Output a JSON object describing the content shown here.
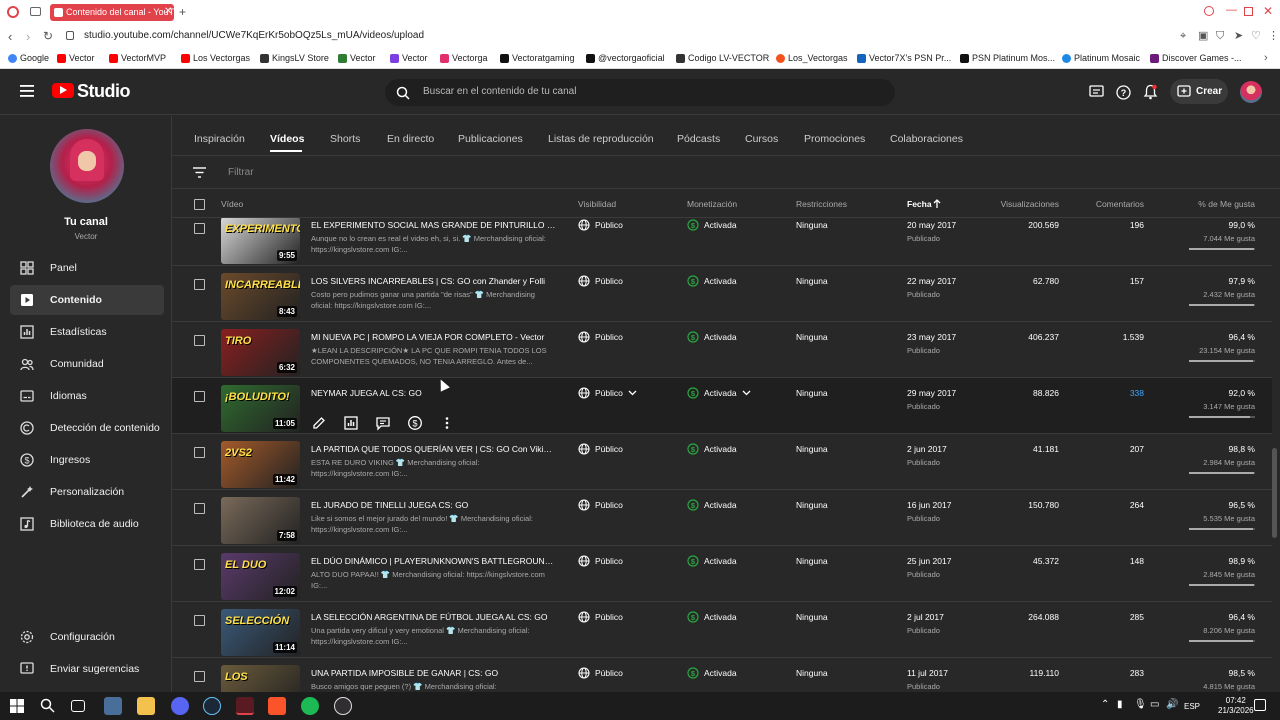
{
  "browser": {
    "tab_title": "Contenido del canal - YouT",
    "url": "studio.youtube.com/channel/UCWe7KqErKr5obOQz5Ls_mUA/videos/upload",
    "bookmarks": [
      {
        "label": "Google",
        "color": "#4285f4"
      },
      {
        "label": "Vector",
        "color": "#ff0000"
      },
      {
        "label": "VectorMVP",
        "color": "#ff0000"
      },
      {
        "label": "Los Vectorgas",
        "color": "#ff0000"
      },
      {
        "label": "KingsLV Store",
        "color": "#333333"
      },
      {
        "label": "Vector",
        "color": "#2e7d32"
      },
      {
        "label": "Vector",
        "color": "#7b3fe4"
      },
      {
        "label": "Vectorga",
        "color": "#e1306c"
      },
      {
        "label": "Vectoratgaming",
        "color": "#111111"
      },
      {
        "label": "@vectorgaoficial",
        "color": "#111111"
      },
      {
        "label": "Codigo LV-VECTOR",
        "color": "#333333"
      },
      {
        "label": "Los_Vectorgas",
        "color": "#f4511e"
      },
      {
        "label": "Vector7X's PSN Pr...",
        "color": "#1565c0"
      },
      {
        "label": "PSN Platinum Mos...",
        "color": "#111111"
      },
      {
        "label": "Platinum Mosaic",
        "color": "#1e88e5"
      },
      {
        "label": "Discover Games -...",
        "color": "#6d1b7b"
      }
    ]
  },
  "header": {
    "logo_text": "Studio",
    "search_placeholder": "Buscar en el contenido de tu canal",
    "create_label": "Crear"
  },
  "sidebar": {
    "your_channel": "Tu canal",
    "channel_name": "Vector",
    "items": [
      {
        "label": "Panel",
        "icon": "dashboard-icon"
      },
      {
        "label": "Contenido",
        "icon": "content-icon",
        "active": true
      },
      {
        "label": "Estadísticas",
        "icon": "analytics-icon"
      },
      {
        "label": "Comunidad",
        "icon": "community-icon"
      },
      {
        "label": "Idiomas",
        "icon": "subtitles-icon"
      },
      {
        "label": "Detección de contenido",
        "icon": "copyright-icon"
      },
      {
        "label": "Ingresos",
        "icon": "monetization-icon"
      },
      {
        "label": "Personalización",
        "icon": "customization-icon"
      },
      {
        "label": "Biblioteca de audio",
        "icon": "audio-library-icon"
      }
    ],
    "bottom_items": [
      {
        "label": "Configuración",
        "icon": "settings-icon"
      },
      {
        "label": "Enviar sugerencias",
        "icon": "feedback-icon"
      }
    ]
  },
  "tabs": [
    "Inspiración",
    "Vídeos",
    "Shorts",
    "En directo",
    "Publicaciones",
    "Listas de reproducción",
    "Pódcasts",
    "Cursos",
    "Promociones",
    "Colaboraciones"
  ],
  "filter_placeholder": "Filtrar",
  "columns": {
    "video": "Vídeo",
    "visibility": "Visibilidad",
    "monetization": "Monetización",
    "restrictions": "Restricciones",
    "date": "Fecha",
    "views": "Visualizaciones",
    "comments": "Comentarios",
    "likes": "% de Me gusta"
  },
  "rows": [
    {
      "title": "EL EXPERIMENTO SOCIAL MAS GRANDE DE PINTURILLO - V...",
      "desc": "Aunque no lo crean es real el video eh, si, si. 👕 Merchandising oficial: https://kingslvstore.com IG:...",
      "duration": "9:55",
      "thumb_text": "EXPERIMENTO",
      "thumb_color": "#d9d9d9",
      "visibility": "Público",
      "monetization": "Activada",
      "restrictions": "Ninguna",
      "date": "20 may 2017",
      "status": "Publicado",
      "views": "200.569",
      "comments": "196",
      "pct": "99,0 %",
      "likes": "7.044 Me gusta",
      "ratio": 0.99
    },
    {
      "title": "LOS SILVERS INCARREABLES | CS: GO con Zhander y Folli",
      "desc": "Costo pero pudimos ganar una partida \"de risas\" 👕 Merchandising oficial: https://kingslvstore.com IG:...",
      "duration": "8:43",
      "thumb_text": "INCARREABLES",
      "thumb_color": "#6b4a2b",
      "visibility": "Público",
      "monetization": "Activada",
      "restrictions": "Ninguna",
      "date": "22 may 2017",
      "status": "Publicado",
      "views": "62.780",
      "comments": "157",
      "pct": "97,9 %",
      "likes": "2.432 Me gusta",
      "ratio": 0.979
    },
    {
      "title": "MI NUEVA PC | ROMPO LA VIEJA POR COMPLETO - Vector",
      "desc": "★LEAN LA DESCRIPCIÓN★ LA PC QUE ROMPI TENIA TODOS LOS COMPONENTES QUEMADOS, NO TENIA ARREGLO. Antes de...",
      "duration": "6:32",
      "thumb_text": "TIRO",
      "thumb_color": "#8a1f1f",
      "visibility": "Público",
      "monetization": "Activada",
      "restrictions": "Ninguna",
      "date": "23 may 2017",
      "status": "Publicado",
      "views": "406.237",
      "comments": "1.539",
      "pct": "96,4 %",
      "likes": "23.154 Me gusta",
      "ratio": 0.964
    },
    {
      "title": "NEYMAR JUEGA AL CS: GO",
      "desc": "",
      "duration": "11:05",
      "thumb_text": "¡BOLUDITO!",
      "thumb_color": "#2f6b2f",
      "visibility": "Público",
      "monetization": "Activada",
      "restrictions": "Ninguna",
      "date": "29 may 2017",
      "status": "Publicado",
      "views": "88.826",
      "comments": "338",
      "pct": "92,0 %",
      "likes": "3.147 Me gusta",
      "ratio": 0.92,
      "hover": true
    },
    {
      "title": "LA PARTIDA QUE TODOS QUERÍAN VER | CS: GO Con VikingES",
      "desc": "ESTA RE DURO VIKING 👕 Merchandising oficial: https://kingslvstore.com IG:...",
      "duration": "11:42",
      "thumb_text": "2VS2",
      "thumb_color": "#a35a2a",
      "visibility": "Público",
      "monetization": "Activada",
      "restrictions": "Ninguna",
      "date": "2 jun 2017",
      "status": "Publicado",
      "views": "41.181",
      "comments": "207",
      "pct": "98,8 %",
      "likes": "2.984 Me gusta",
      "ratio": 0.988
    },
    {
      "title": "EL JURADO DE TINELLI JUEGA CS: GO",
      "desc": "Like si somos el mejor jurado del mundo! 👕 Merchandising oficial: https://kingslvstore.com IG:...",
      "duration": "7:58",
      "thumb_text": "",
      "thumb_color": "#7a6a5a",
      "visibility": "Público",
      "monetization": "Activada",
      "restrictions": "Ninguna",
      "date": "16 jun 2017",
      "status": "Publicado",
      "views": "150.780",
      "comments": "264",
      "pct": "96,5 %",
      "likes": "5.535 Me gusta",
      "ratio": 0.965
    },
    {
      "title": "EL DÚO DINÁMICO | PLAYERUNKNOWN'S BATTLEGROUNDS...",
      "desc": "ALTO DUO PAPAA!! 👕 Merchandising oficial: https://kingslvstore.com IG:...",
      "duration": "12:02",
      "thumb_text": "EL DUO",
      "thumb_color": "#5a3a6b",
      "visibility": "Público",
      "monetization": "Activada",
      "restrictions": "Ninguna",
      "date": "25 jun 2017",
      "status": "Publicado",
      "views": "45.372",
      "comments": "148",
      "pct": "98,9 %",
      "likes": "2.845 Me gusta",
      "ratio": 0.989
    },
    {
      "title": "LA SELECCIÓN ARGENTINA DE FÚTBOL JUEGA AL CS: GO",
      "desc": "Una partida very dificul y very emotional 👕 Merchandising oficial: https://kingslvstore.com IG:...",
      "duration": "11:14",
      "thumb_text": "SELECCIÓN",
      "thumb_color": "#3a5a7a",
      "visibility": "Público",
      "monetization": "Activada",
      "restrictions": "Ninguna",
      "date": "2 jul 2017",
      "status": "Publicado",
      "views": "264.088",
      "comments": "285",
      "pct": "96,4 %",
      "likes": "8.206 Me gusta",
      "ratio": 0.964
    },
    {
      "title": "UNA PARTIDA IMPOSIBLE DE GANAR | CS: GO",
      "desc": "Busco amigos que peguen (?) 👕 Merchandising oficial:",
      "duration": "",
      "thumb_text": "LOS",
      "thumb_color": "#6a5a3a",
      "visibility": "Público",
      "monetization": "Activada",
      "restrictions": "Ninguna",
      "date": "11 jul 2017",
      "status": "Publicado",
      "views": "119.110",
      "comments": "283",
      "pct": "98,5 %",
      "likes": "4.815 Me gusta",
      "ratio": 0.985
    }
  ],
  "taskbar": {
    "language": "ESP",
    "time": "07:42",
    "date": "21/3/2026"
  }
}
